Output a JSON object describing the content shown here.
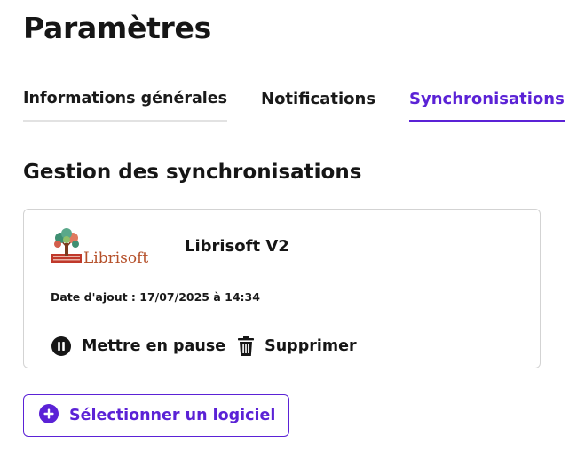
{
  "page": {
    "title": "Paramètres"
  },
  "tabs": [
    {
      "label": "Informations générales",
      "active": false
    },
    {
      "label": "Notifications",
      "active": false
    },
    {
      "label": "Synchronisations",
      "active": true
    }
  ],
  "section": {
    "title": "Gestion des synchronisations"
  },
  "sync_card": {
    "logo_text": "Librisoft",
    "software_name": "Librisoft V2",
    "date_added": "Date d'ajout : 17/07/2025 à 14:34",
    "actions": {
      "pause_label": "Mettre en pause",
      "pause_icon": "pause-circle-icon",
      "delete_label": "Supprimer",
      "delete_icon": "trash-icon"
    }
  },
  "select_button": {
    "label": "Sélectionner un logiciel",
    "icon": "plus-circle-icon"
  },
  "colors": {
    "accent": "#5b22d6",
    "text": "#161616",
    "border": "#d3d3d3",
    "tab_inactive_border": "#e2e2e2",
    "logo_red": "#b5502a",
    "logo_tree_green": "#3f8f72"
  }
}
